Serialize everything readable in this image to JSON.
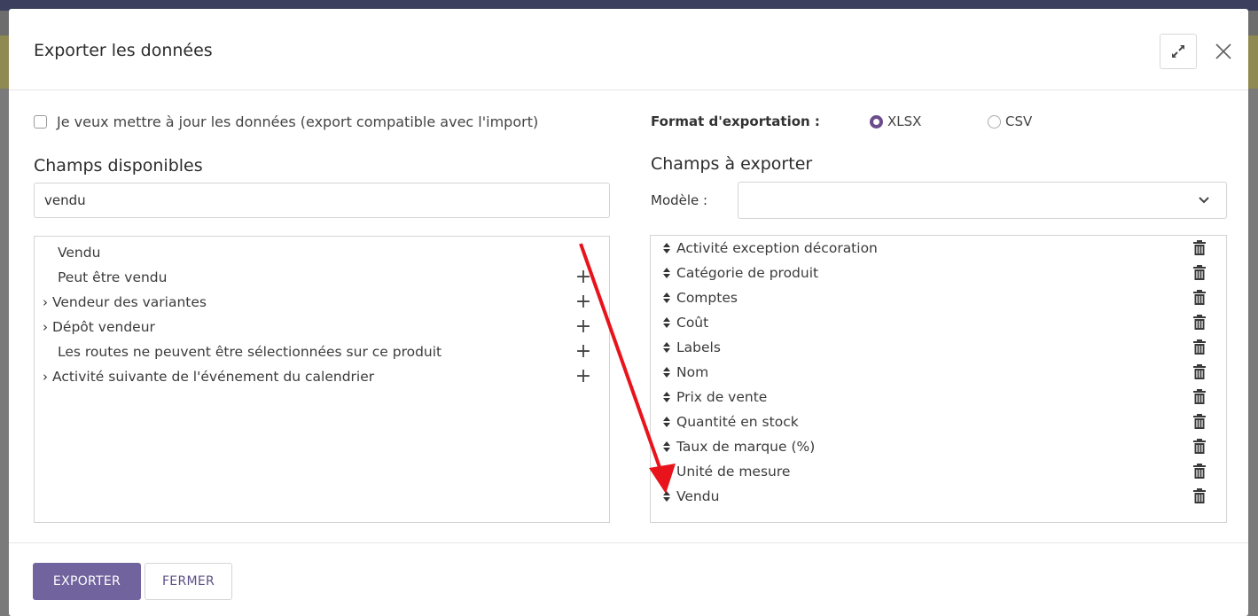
{
  "dialog": {
    "title": "Exporter les données",
    "expand_icon": "expand-arrows-icon",
    "close_icon": "close-x-icon"
  },
  "options": {
    "update_label": "Je veux mettre à jour les données (export compatible avec l'import)",
    "update_checked": false,
    "format_label": "Format d'exportation :",
    "formats": [
      {
        "label": "XLSX",
        "selected": true
      },
      {
        "label": "CSV",
        "selected": false
      }
    ]
  },
  "available": {
    "title": "Champs disponibles",
    "search_value": "vendu",
    "items": [
      {
        "label": "Vendu",
        "expandable": false
      },
      {
        "label": "Peut être vendu",
        "expandable": false
      },
      {
        "label": "Vendeur des variantes",
        "expandable": true
      },
      {
        "label": "Dépôt vendeur",
        "expandable": true
      },
      {
        "label": "Les routes ne peuvent être sélectionnées sur ce produit",
        "expandable": false
      },
      {
        "label": "Activité suivante de l'événement du calendrier",
        "expandable": true
      }
    ],
    "add_glyph": "+",
    "expand_glyph": "›"
  },
  "export": {
    "title": "Champs à exporter",
    "template_label": "Modèle :",
    "template_value": "",
    "fields": [
      "Activité exception décoration",
      "Catégorie de produit",
      "Comptes",
      "Coût",
      "Labels",
      "Nom",
      "Prix de vente",
      "Quantité en stock",
      "Taux de marque (%)",
      "Unité de mesure",
      "Vendu"
    ]
  },
  "footer": {
    "export_button": "EXPORTER",
    "close_button": "FERMER"
  },
  "colors": {
    "primary": "#71639e",
    "annotation_arrow": "#e8131b"
  }
}
